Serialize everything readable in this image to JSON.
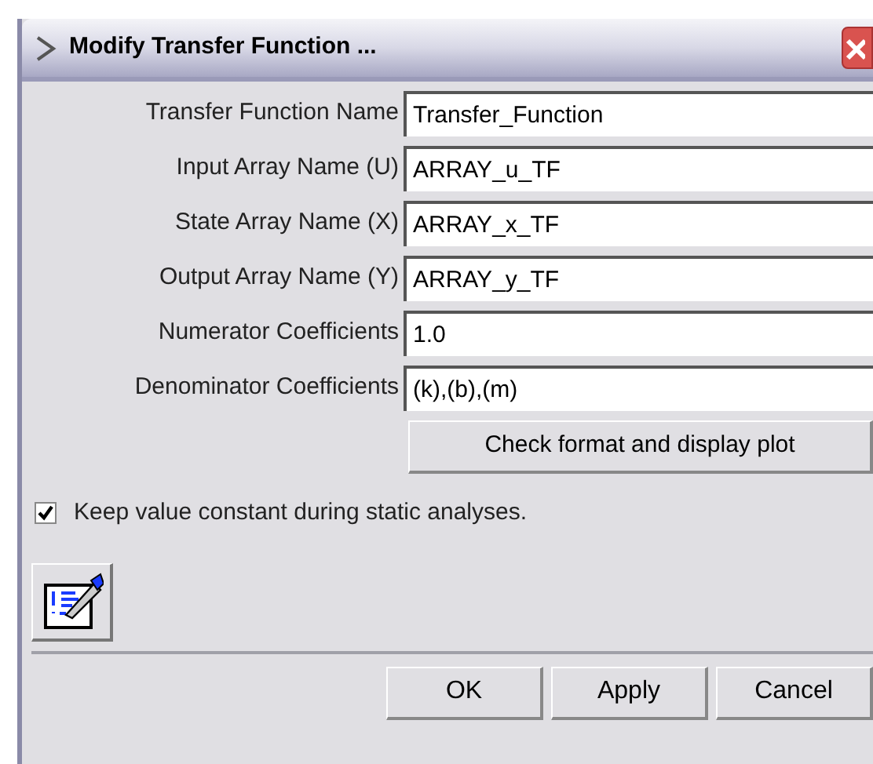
{
  "window": {
    "title": "Modify Transfer Function ..."
  },
  "fields": [
    {
      "label": "Transfer Function Name",
      "value": "Transfer_Function"
    },
    {
      "label": "Input Array Name (U)",
      "value": "ARRAY_u_TF"
    },
    {
      "label": "State Array Name (X)",
      "value": "ARRAY_x_TF"
    },
    {
      "label": "Output Array Name (Y)",
      "value": "ARRAY_y_TF"
    },
    {
      "label": "Numerator Coefficients",
      "value": "1.0"
    },
    {
      "label": "Denominator Coefficients",
      "value": "(k),(b),(m)"
    }
  ],
  "check_button": "Check format and display plot",
  "checkbox": {
    "label": "Keep value constant during static analyses.",
    "checked": true
  },
  "buttons": [
    "OK",
    "Apply",
    "Cancel"
  ]
}
